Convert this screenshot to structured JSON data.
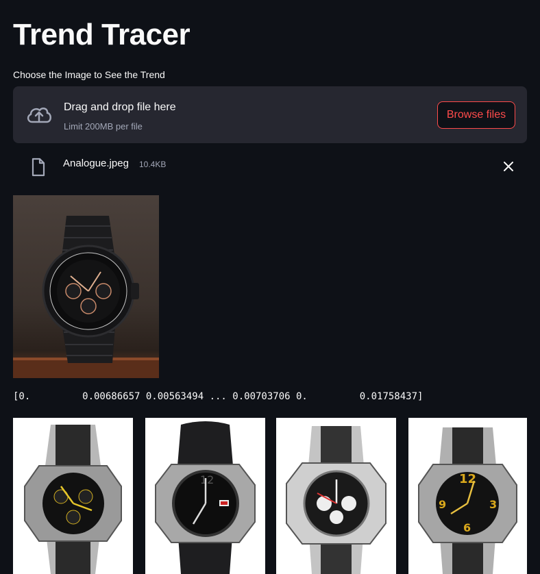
{
  "page": {
    "title": "Trend Tracer"
  },
  "uploader": {
    "label": "Choose the Image to See the Trend",
    "drop_text": "Drag and drop file here",
    "limit_text": "Limit 200MB per file",
    "browse_label": "Browse files",
    "accent_color": "#ff4b4b"
  },
  "uploaded_file": {
    "name": "Analogue.jpeg",
    "size": "10.4KB"
  },
  "features_output": "[0.         0.00686657 0.00563494 ... 0.00703706 0.         0.01758437]",
  "results": [
    {
      "image": "watch-chronograph-yellow"
    },
    {
      "image": "watch-black-rubber"
    },
    {
      "image": "watch-silver-chronograph"
    },
    {
      "image": "watch-yellow-dial"
    }
  ]
}
